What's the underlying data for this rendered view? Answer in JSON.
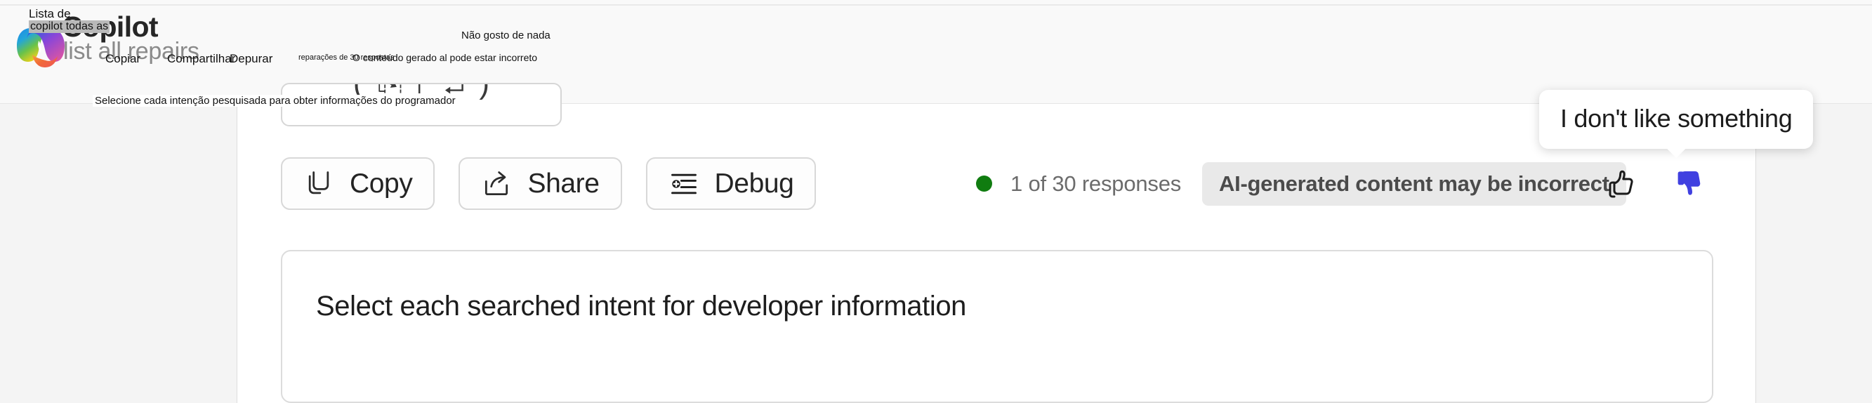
{
  "header": {
    "app_title": "Copilot",
    "prompt_text": "list all repairs",
    "logo_icon": "copilot-logo-icon"
  },
  "overlays": {
    "lista_de": "Lista de",
    "copilot_todas_as": "copilot todas as",
    "copiar": "Copiar",
    "compartilhar": "Compartilhar",
    "depurar": "Depurar",
    "nao_gosto_de_nada": "Não gosto de nada",
    "reparacoes": "reparações de 30 respostas",
    "conteudo_gerado": "O conteúdo gerado al pode estar incorreto",
    "selecione_intencao": "Selecione cada intenção pesquisada para obter informações do programador"
  },
  "actions": [
    {
      "label": "Copy",
      "icon": "copy-icon"
    },
    {
      "label": "Share",
      "icon": "share-icon"
    },
    {
      "label": "Debug",
      "icon": "debug-list-icon"
    }
  ],
  "status": {
    "dot_color": "#107c10",
    "responses_text": "1 of 30 responses",
    "ai_disclaimer": "AI-generated content may be incorrect"
  },
  "feedback": {
    "thumbs_up_icon": "thumbs-up-icon",
    "thumbs_down_icon": "thumbs-down-icon",
    "thumbs_down_active_color": "#4040e0",
    "tooltip_text": "I don't like something"
  },
  "content": {
    "heading": "Select each searched intent for developer information"
  },
  "clipped_top_box": {
    "glyphs": "( ⎘    ↱    ↵ )"
  }
}
